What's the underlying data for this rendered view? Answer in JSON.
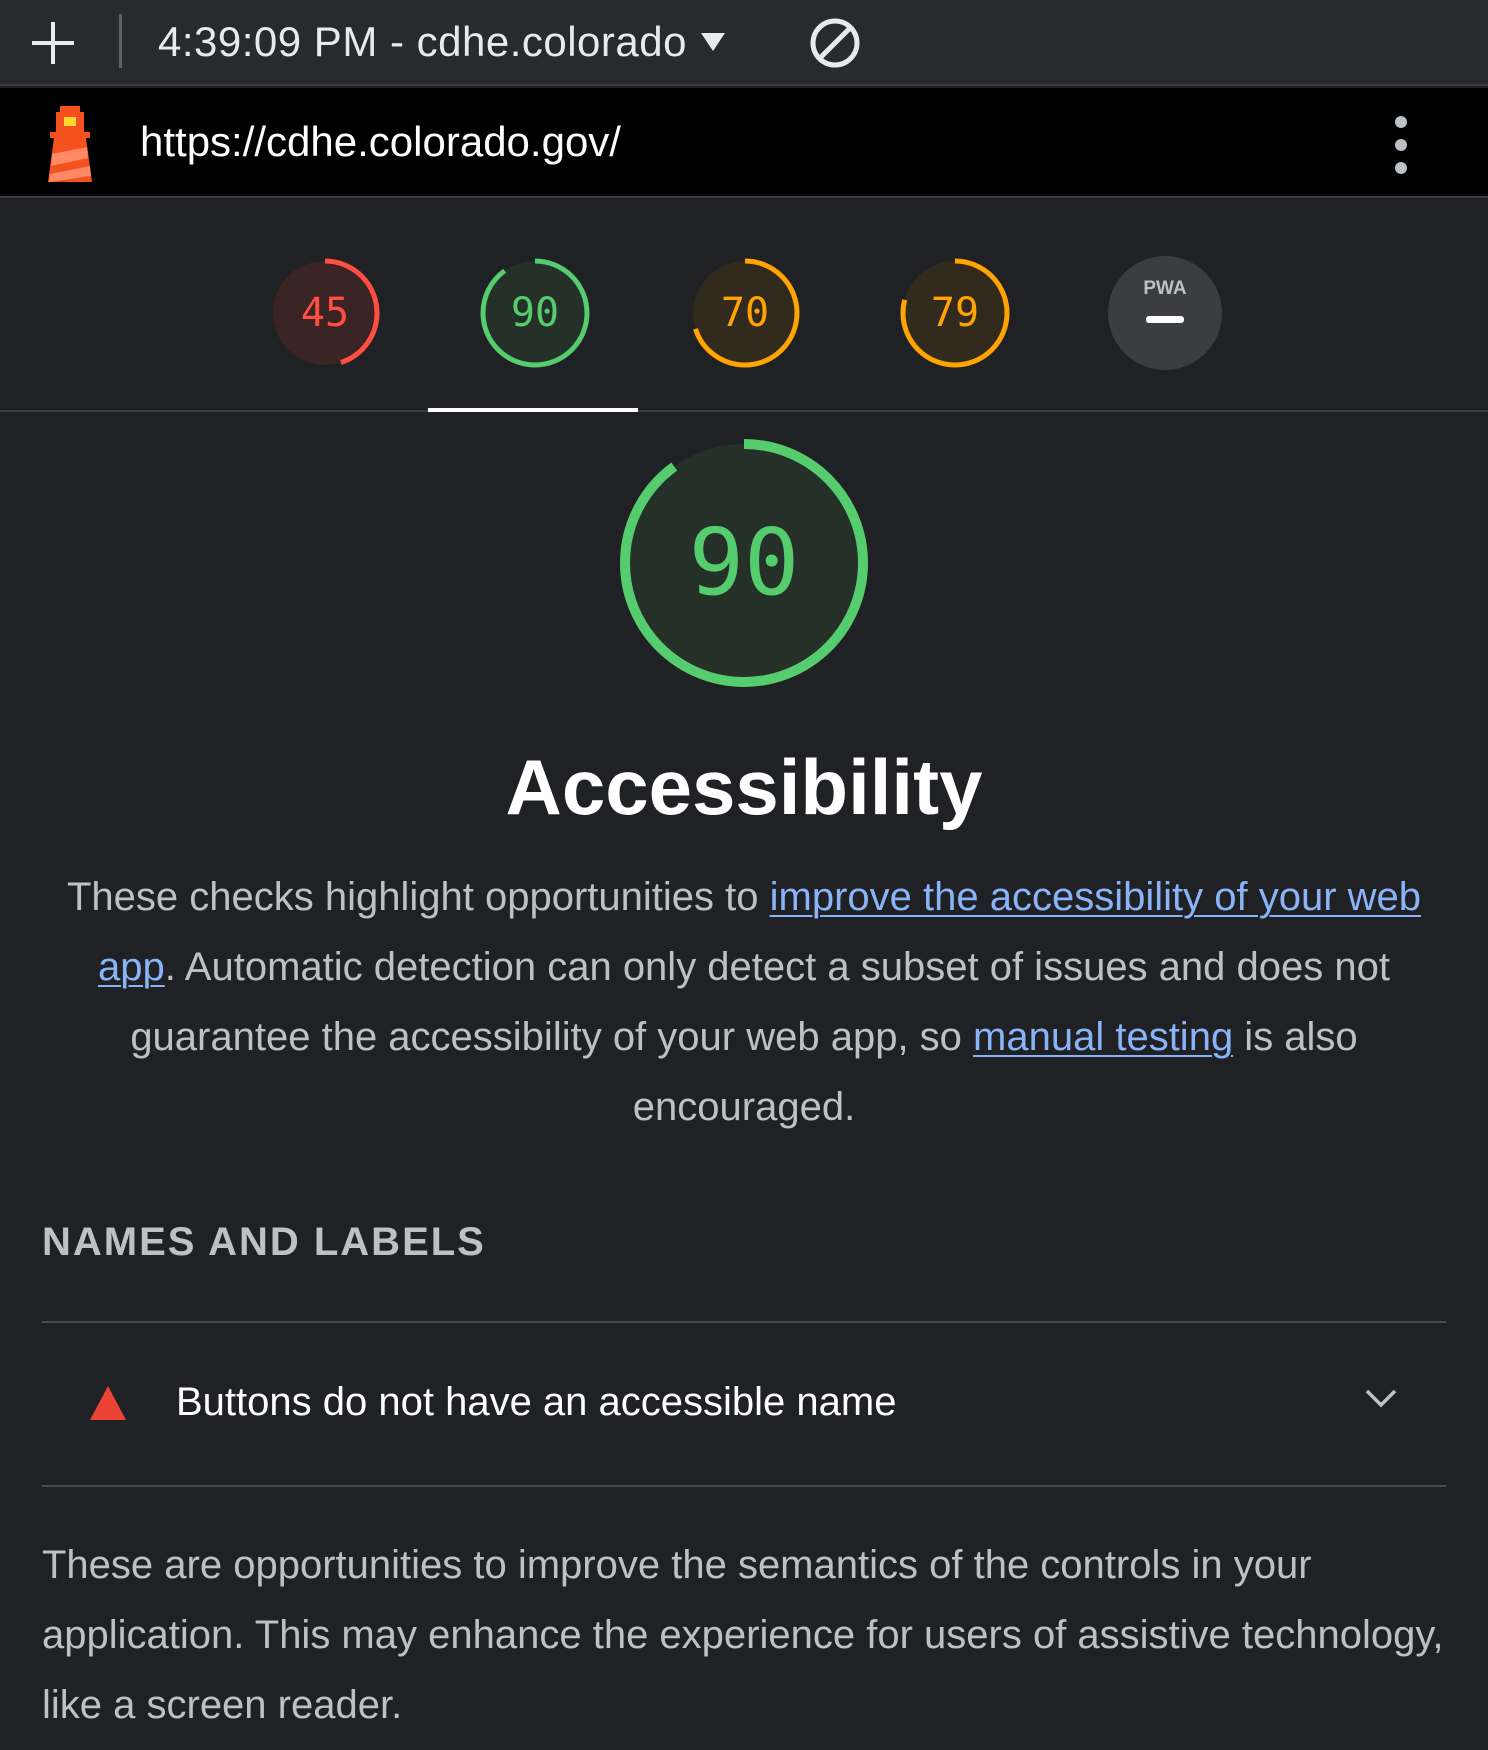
{
  "toolbar": {
    "report_label": "4:39:09 PM - cdhe.colorado",
    "icons": [
      "plus-icon",
      "caret-down-icon",
      "clear-icon"
    ]
  },
  "urlbar": {
    "url": "https://cdhe.colorado.gov/",
    "icons": [
      "lighthouse-logo",
      "more-vertical-icon"
    ]
  },
  "gauges": [
    {
      "category": "performance",
      "score": 45,
      "color": "#ff4e42",
      "fill": "#3a2424"
    },
    {
      "category": "accessibility",
      "score": 90,
      "color": "#55cc6e",
      "fill": "#253028",
      "selected": true
    },
    {
      "category": "best-practices",
      "score": 70,
      "color": "#ffa400",
      "fill": "#332a1e"
    },
    {
      "category": "seo",
      "score": 79,
      "color": "#ffa400",
      "fill": "#332a1e"
    },
    {
      "category": "pwa",
      "score": null,
      "badge": "PWA"
    }
  ],
  "main": {
    "score": "90",
    "score_fraction": 0.9,
    "title": "Accessibility",
    "description": {
      "part1": "These checks highlight opportunities to ",
      "link1": "improve the accessibility of your web app",
      "part2": ". Automatic detection can only detect a subset of issues and does not guarantee the accessibility of your web app, so ",
      "link2": "manual testing",
      "part3": " is also encouraged."
    }
  },
  "group": {
    "title": "NAMES AND LABELS",
    "audit": {
      "title": "Buttons do not have an accessible name",
      "status": "fail",
      "status_color": "#eb4335"
    },
    "description": "These are opportunities to improve the semantics of the controls in your application. This may enhance the experience for users of assistive technology, like a screen reader."
  }
}
